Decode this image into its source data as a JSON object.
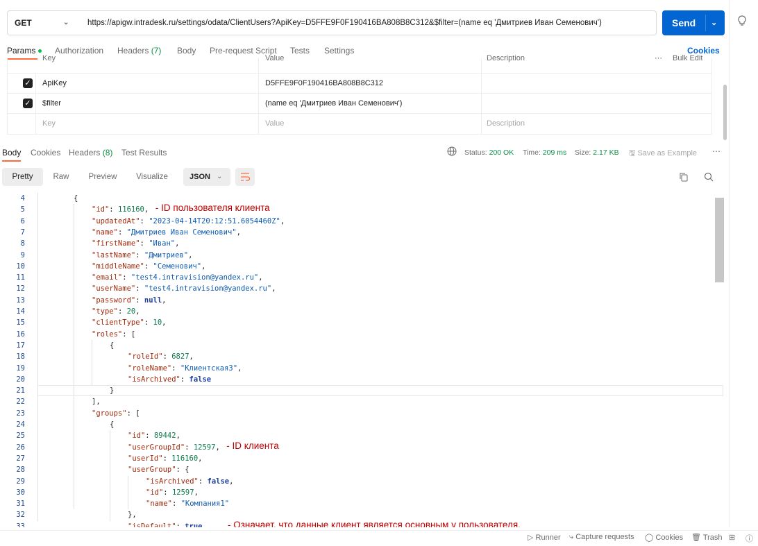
{
  "request": {
    "method": "GET",
    "url": "https://apigw.intradesk.ru/settings/odata/ClientUsers?ApiKey=D5FFE9F0F190416BA808B8C312&$filter=(name eq 'Дмитриев Иван Семенович')",
    "send_label": "Send"
  },
  "request_tabs": {
    "params": "Params",
    "authorization": "Authorization",
    "headers": "Headers",
    "headers_count": "(7)",
    "body": "Body",
    "prerequest": "Pre-request Script",
    "tests": "Tests",
    "settings": "Settings",
    "cookies": "Cookies"
  },
  "params_table": {
    "headers": {
      "key": "Key",
      "value": "Value",
      "description": "Description",
      "bulk_edit": "Bulk Edit"
    },
    "rows": [
      {
        "checked": true,
        "key": "ApiKey",
        "value": "D5FFE9F0F190416BA808B8C312",
        "description": ""
      },
      {
        "checked": true,
        "key": "$filter",
        "value": "(name eq 'Дмитриев Иван Семенович')",
        "description": ""
      }
    ],
    "placeholders": {
      "key": "Key",
      "value": "Value",
      "description": "Description"
    }
  },
  "response_tabs": {
    "body": "Body",
    "cookies": "Cookies",
    "headers": "Headers",
    "headers_count": "(8)",
    "test_results": "Test Results"
  },
  "response_status": {
    "status_label": "Status:",
    "status_value": "200 OK",
    "time_label": "Time:",
    "time_value": "209 ms",
    "size_label": "Size:",
    "size_value": "2.17 KB",
    "save_example": "Save as Example"
  },
  "view_modes": [
    "Pretty",
    "Raw",
    "Preview",
    "Visualize"
  ],
  "format": "JSON",
  "code_lines": [
    {
      "n": "4",
      "indent": 0,
      "parts": [
        [
          "p",
          "{"
        ]
      ]
    },
    {
      "n": "5",
      "indent": 1,
      "parts": [
        [
          "k",
          "\"id\""
        ],
        [
          "p",
          ": "
        ],
        [
          "n",
          "116160"
        ],
        [
          "p",
          ","
        ]
      ]
    },
    {
      "n": "6",
      "indent": 1,
      "parts": [
        [
          "k",
          "\"updatedAt\""
        ],
        [
          "p",
          ": "
        ],
        [
          "s",
          "\"2023-04-14T20:12:51.6054460Z\""
        ],
        [
          "p",
          ","
        ]
      ]
    },
    {
      "n": "7",
      "indent": 1,
      "parts": [
        [
          "k",
          "\"name\""
        ],
        [
          "p",
          ": "
        ],
        [
          "s",
          "\"Дмитриев Иван Семенович\""
        ],
        [
          "p",
          ","
        ]
      ]
    },
    {
      "n": "8",
      "indent": 1,
      "parts": [
        [
          "k",
          "\"firstName\""
        ],
        [
          "p",
          ": "
        ],
        [
          "s",
          "\"Иван\""
        ],
        [
          "p",
          ","
        ]
      ]
    },
    {
      "n": "9",
      "indent": 1,
      "parts": [
        [
          "k",
          "\"lastName\""
        ],
        [
          "p",
          ": "
        ],
        [
          "s",
          "\"Дмитриев\""
        ],
        [
          "p",
          ","
        ]
      ]
    },
    {
      "n": "10",
      "indent": 1,
      "parts": [
        [
          "k",
          "\"middleName\""
        ],
        [
          "p",
          ": "
        ],
        [
          "s",
          "\"Семенович\""
        ],
        [
          "p",
          ","
        ]
      ]
    },
    {
      "n": "11",
      "indent": 1,
      "parts": [
        [
          "k",
          "\"email\""
        ],
        [
          "p",
          ": "
        ],
        [
          "s",
          "\"test4.intravision@yandex.ru\""
        ],
        [
          "p",
          ","
        ]
      ]
    },
    {
      "n": "12",
      "indent": 1,
      "parts": [
        [
          "k",
          "\"userName\""
        ],
        [
          "p",
          ": "
        ],
        [
          "s",
          "\"test4.intravision@yandex.ru\""
        ],
        [
          "p",
          ","
        ]
      ]
    },
    {
      "n": "13",
      "indent": 1,
      "parts": [
        [
          "k",
          "\"password\""
        ],
        [
          "p",
          ": "
        ],
        [
          "kw",
          "null"
        ],
        [
          "p",
          ","
        ]
      ]
    },
    {
      "n": "14",
      "indent": 1,
      "parts": [
        [
          "k",
          "\"type\""
        ],
        [
          "p",
          ": "
        ],
        [
          "n",
          "20"
        ],
        [
          "p",
          ","
        ]
      ]
    },
    {
      "n": "15",
      "indent": 1,
      "parts": [
        [
          "k",
          "\"clientType\""
        ],
        [
          "p",
          ": "
        ],
        [
          "n",
          "10"
        ],
        [
          "p",
          ","
        ]
      ]
    },
    {
      "n": "16",
      "indent": 1,
      "parts": [
        [
          "k",
          "\"roles\""
        ],
        [
          "p",
          ": ["
        ]
      ]
    },
    {
      "n": "17",
      "indent": 2,
      "parts": [
        [
          "p",
          "{"
        ]
      ]
    },
    {
      "n": "18",
      "indent": 3,
      "parts": [
        [
          "k",
          "\"roleId\""
        ],
        [
          "p",
          ": "
        ],
        [
          "n",
          "6827"
        ],
        [
          "p",
          ","
        ]
      ]
    },
    {
      "n": "19",
      "indent": 3,
      "parts": [
        [
          "k",
          "\"roleName\""
        ],
        [
          "p",
          ": "
        ],
        [
          "s",
          "\"Клиентская3\""
        ],
        [
          "p",
          ","
        ]
      ]
    },
    {
      "n": "20",
      "indent": 3,
      "parts": [
        [
          "k",
          "\"isArchived\""
        ],
        [
          "p",
          ": "
        ],
        [
          "kw",
          "false"
        ]
      ]
    },
    {
      "n": "21",
      "indent": 2,
      "parts": [
        [
          "p",
          "}"
        ]
      ]
    },
    {
      "n": "22",
      "indent": 1,
      "parts": [
        [
          "p",
          "],"
        ]
      ]
    },
    {
      "n": "23",
      "indent": 1,
      "parts": [
        [
          "k",
          "\"groups\""
        ],
        [
          "p",
          ": ["
        ]
      ]
    },
    {
      "n": "24",
      "indent": 2,
      "parts": [
        [
          "p",
          "{"
        ]
      ]
    },
    {
      "n": "25",
      "indent": 3,
      "parts": [
        [
          "k",
          "\"id\""
        ],
        [
          "p",
          ": "
        ],
        [
          "n",
          "89442"
        ],
        [
          "p",
          ","
        ]
      ]
    },
    {
      "n": "26",
      "indent": 3,
      "parts": [
        [
          "k",
          "\"userGroupId\""
        ],
        [
          "p",
          ": "
        ],
        [
          "n",
          "12597"
        ],
        [
          "p",
          ","
        ]
      ]
    },
    {
      "n": "27",
      "indent": 3,
      "parts": [
        [
          "k",
          "\"userId\""
        ],
        [
          "p",
          ": "
        ],
        [
          "n",
          "116160"
        ],
        [
          "p",
          ","
        ]
      ]
    },
    {
      "n": "28",
      "indent": 3,
      "parts": [
        [
          "k",
          "\"userGroup\""
        ],
        [
          "p",
          ": {"
        ]
      ]
    },
    {
      "n": "29",
      "indent": 4,
      "parts": [
        [
          "k",
          "\"isArchived\""
        ],
        [
          "p",
          ": "
        ],
        [
          "kw",
          "false"
        ],
        [
          "p",
          ","
        ]
      ]
    },
    {
      "n": "30",
      "indent": 4,
      "parts": [
        [
          "k",
          "\"id\""
        ],
        [
          "p",
          ": "
        ],
        [
          "n",
          "12597"
        ],
        [
          "p",
          ","
        ]
      ]
    },
    {
      "n": "31",
      "indent": 4,
      "parts": [
        [
          "k",
          "\"name\""
        ],
        [
          "p",
          ": "
        ],
        [
          "s",
          "\"Компания1\""
        ]
      ]
    },
    {
      "n": "32",
      "indent": 3,
      "parts": [
        [
          "p",
          "},"
        ]
      ]
    },
    {
      "n": "33",
      "indent": 3,
      "parts": [
        [
          "k",
          "\"isDefault\""
        ],
        [
          "p",
          ": "
        ],
        [
          "kw",
          "true"
        ],
        [
          "p",
          ","
        ]
      ]
    }
  ],
  "annotations": [
    {
      "line": "5",
      "text": "- ID пользователя клиента"
    },
    {
      "line": "26",
      "text": "- ID клиента"
    },
    {
      "line": "33",
      "text": "- Означает, что данные клиент является основным у пользователя."
    }
  ],
  "footer": {
    "runner": "Runner",
    "capture": "Capture requests",
    "cookies": "Cookies",
    "trash": "Trash"
  }
}
